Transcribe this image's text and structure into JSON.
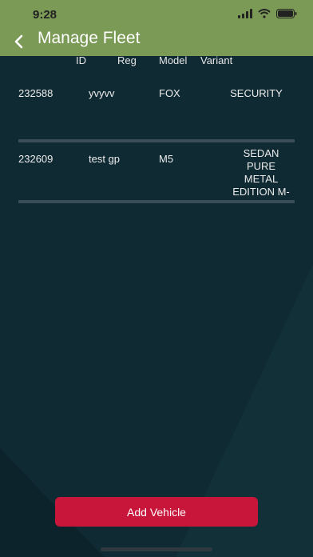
{
  "status_bar": {
    "time": "9:28"
  },
  "nav": {
    "title": "Manage Fleet"
  },
  "table": {
    "headers": {
      "id": "ID",
      "reg": "Reg",
      "model": "Model",
      "variant": "Variant"
    },
    "rows": [
      {
        "number": "232588",
        "reg": "yvyvv",
        "model": "FOX",
        "variant_lines": [
          "SECURITY"
        ]
      },
      {
        "number": "232609",
        "reg": "test gp",
        "model": "M5",
        "variant_lines": [
          "SEDAN",
          "PURE",
          "METAL",
          "EDITION M-"
        ]
      }
    ]
  },
  "footer": {
    "add_vehicle_label": "Add Vehicle"
  },
  "colors": {
    "header": "#7a9a56",
    "background": "#0f2a33",
    "accent": "#c8163b"
  },
  "icons": [
    "back-chevron-icon",
    "signal-icon",
    "wifi-icon",
    "battery-icon"
  ]
}
